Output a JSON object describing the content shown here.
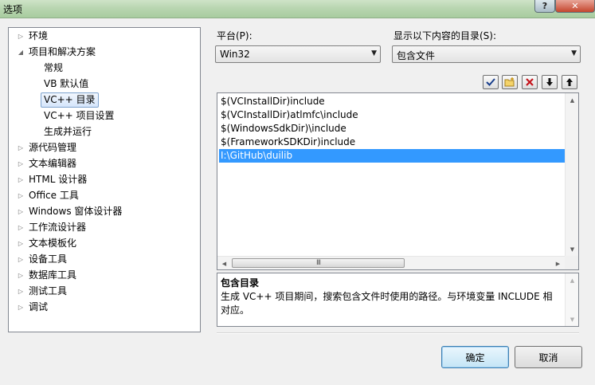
{
  "window": {
    "title": "选项",
    "help_label": "?",
    "close_label": "✕"
  },
  "tree": {
    "items": [
      {
        "label": "环境",
        "level": 0,
        "arrow": "▷"
      },
      {
        "label": "项目和解决方案",
        "level": 0,
        "arrow": "◢"
      },
      {
        "label": "常规",
        "level": 1,
        "arrow": ""
      },
      {
        "label": "VB 默认值",
        "level": 1,
        "arrow": ""
      },
      {
        "label": "VC++ 目录",
        "level": 1,
        "arrow": "",
        "selected": true
      },
      {
        "label": "VC++ 项目设置",
        "level": 1,
        "arrow": ""
      },
      {
        "label": "生成并运行",
        "level": 1,
        "arrow": ""
      },
      {
        "label": "源代码管理",
        "level": 0,
        "arrow": "▷"
      },
      {
        "label": "文本编辑器",
        "level": 0,
        "arrow": "▷"
      },
      {
        "label": "HTML 设计器",
        "level": 0,
        "arrow": "▷"
      },
      {
        "label": "Office 工具",
        "level": 0,
        "arrow": "▷"
      },
      {
        "label": "Windows 窗体设计器",
        "level": 0,
        "arrow": "▷"
      },
      {
        "label": "工作流设计器",
        "level": 0,
        "arrow": "▷"
      },
      {
        "label": "文本模板化",
        "level": 0,
        "arrow": "▷"
      },
      {
        "label": "设备工具",
        "level": 0,
        "arrow": "▷"
      },
      {
        "label": "数据库工具",
        "level": 0,
        "arrow": "▷"
      },
      {
        "label": "测试工具",
        "level": 0,
        "arrow": "▷"
      },
      {
        "label": "调试",
        "level": 0,
        "arrow": "▷"
      }
    ]
  },
  "platform": {
    "label": "平台(P):",
    "value": "Win32"
  },
  "show_dirs": {
    "label": "显示以下内容的目录(S):",
    "value": "包含文件"
  },
  "toolbar": {
    "check_icon": "checkmark-icon",
    "folder_icon": "new-folder-icon",
    "delete_icon": "delete-x-icon",
    "down_icon": "arrow-down-icon",
    "up_icon": "arrow-up-icon"
  },
  "dir_list": {
    "rows": [
      {
        "text": "$(VCInstallDir)include"
      },
      {
        "text": "$(VCInstallDir)atlmfc\\include"
      },
      {
        "text": "$(WindowsSdkDir)\\include"
      },
      {
        "text": "$(FrameworkSDKDir)include"
      },
      {
        "text": "I:\\GitHub\\duilib",
        "selected": true
      }
    ],
    "hscroll_grip": "III"
  },
  "description": {
    "title": "包含目录",
    "text": "生成 VC++ 项目期间，搜索包含文件时使用的路径。与环境变量 INCLUDE 相对应。"
  },
  "buttons": {
    "ok": "确定",
    "cancel": "取消"
  },
  "colors": {
    "selection": "#3399ff",
    "titlebar": "#b9d6b1"
  }
}
